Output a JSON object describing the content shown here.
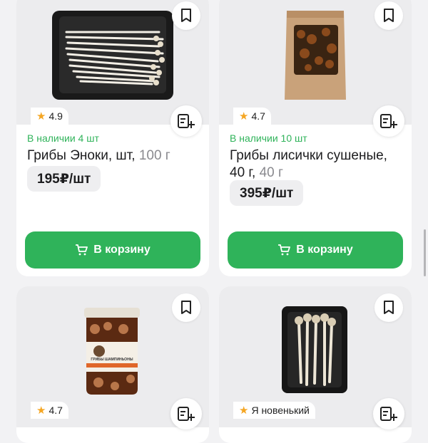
{
  "products": [
    {
      "rating": "4.9",
      "stock": "В наличии 4 шт",
      "name": "Грибы Эноки, шт,",
      "weight": "100 г",
      "price": "195₽/шт",
      "cart_label": "В корзину"
    },
    {
      "rating": "4.7",
      "stock": "В наличии 10 шт",
      "name_line1": "Грибы лисички сушеные,",
      "name_line2": "40 г,",
      "weight": "40 г",
      "price": "395₽/шт",
      "cart_label": "В корзину"
    },
    {
      "rating": "4.7",
      "jar_label": "ГРИБЫ ШАМПИНЬОНЫ"
    },
    {
      "rating": "Я новенький"
    }
  ],
  "icons": {
    "bookmark": "bookmark-icon",
    "add_to_list": "add-to-list-icon",
    "cart": "cart-icon",
    "star": "star-icon"
  },
  "colors": {
    "accent": "#2fb35a",
    "star": "#f5a623"
  }
}
